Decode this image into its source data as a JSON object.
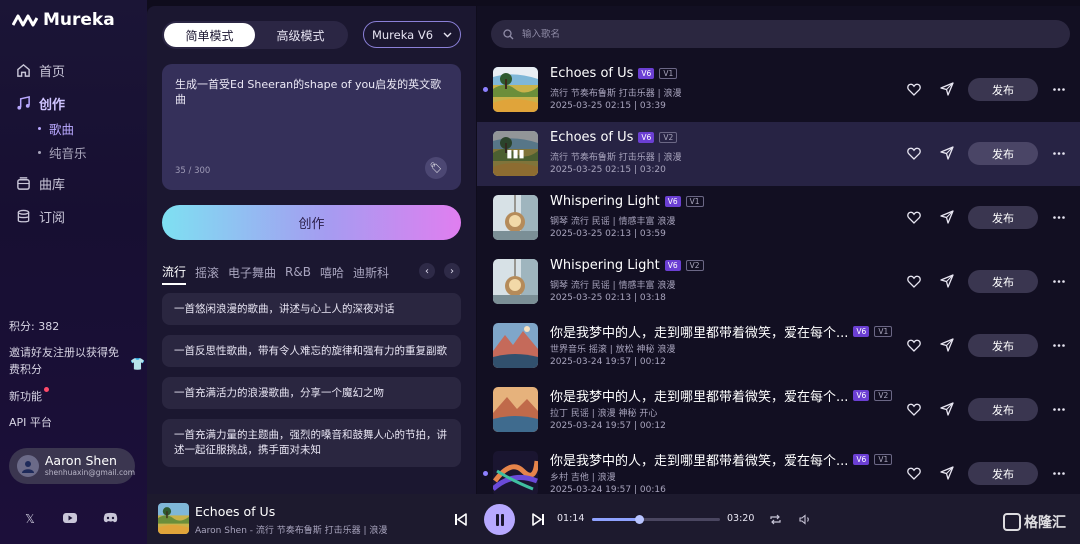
{
  "app": {
    "name": "Mureka"
  },
  "sidebar": {
    "nav": [
      {
        "label": "首页",
        "icon": "home-icon"
      },
      {
        "label": "创作",
        "icon": "music-note-icon",
        "active": true
      },
      {
        "label": "曲库",
        "icon": "library-icon"
      },
      {
        "label": "订阅",
        "icon": "database-icon"
      }
    ],
    "sub_nav": [
      {
        "label": "歌曲",
        "active": true
      },
      {
        "label": "纯音乐"
      }
    ],
    "credits": "积分: 382",
    "invite": "邀请好友注册以获得免费积分",
    "new_features": "新功能",
    "api": "API 平台",
    "user": {
      "name": "Aaron Shen",
      "email": "shenhuaxin@gmail.com"
    },
    "socials": [
      "x-icon",
      "youtube-icon",
      "discord-icon"
    ]
  },
  "create": {
    "modes": [
      "简单模式",
      "高级模式"
    ],
    "active_mode": "简单模式",
    "version": "Mureka V6",
    "prompt": "生成一首受Ed Sheeran的shape of you启发的英文歌曲",
    "counter": "35 / 300",
    "create_label": "创作",
    "genres": [
      "流行",
      "摇滚",
      "电子舞曲",
      "R&B",
      "嘻哈",
      "迪斯科"
    ],
    "active_genre": "流行",
    "suggestions": [
      "一首悠闲浪漫的歌曲，讲述与心上人的深夜对话",
      "一首反思性歌曲，带有令人难忘的旋律和强有力的重复副歌",
      "一首充满活力的浪漫歌曲，分享一个魔幻之吻",
      "一首充满力量的主题曲，强烈的嗓音和鼓舞人心的节拍，讲述一起征服挑战，携手面对未知"
    ]
  },
  "list": {
    "search_placeholder": "输入歌名",
    "publish_label": "发布",
    "songs": [
      {
        "title": "Echoes of Us",
        "version": "V1",
        "tags": "流行 节奏布鲁斯 打击乐器 | 浪漫",
        "date": "2025-03-25 02:15",
        "duration": "03:39",
        "thumb": "meadow"
      },
      {
        "title": "Echoes of Us",
        "version": "V2",
        "tags": "流行 节奏布鲁斯 打击乐器 | 浪漫",
        "date": "2025-03-25 02:15",
        "duration": "03:20",
        "thumb": "meadow"
      },
      {
        "title": "Whispering Light",
        "version": "V1",
        "tags": "钢琴 流行 民谣 | 情感丰富 浪漫",
        "date": "2025-03-25 02:13",
        "duration": "03:59",
        "thumb": "lamp"
      },
      {
        "title": "Whispering Light",
        "version": "V2",
        "tags": "钢琴 流行 民谣 | 情感丰富 浪漫",
        "date": "2025-03-25 02:13",
        "duration": "03:18",
        "thumb": "lamp"
      },
      {
        "title": "你是我梦中的人，走到哪里都带着微笑，爱在每个...",
        "version": "V1",
        "tags": "世界音乐 摇滚 | 放松 神秘 浪漫",
        "date": "2025-03-24 19:57",
        "duration": "00:12",
        "thumb": "mountain"
      },
      {
        "title": "你是我梦中的人，走到哪里都带着微笑，爱在每个...",
        "version": "V2",
        "tags": "拉丁 民谣 | 浪漫 神秘 开心",
        "date": "2025-03-24 19:57",
        "duration": "00:12",
        "thumb": "mountain2"
      },
      {
        "title": "你是我梦中的人，走到哪里都带着微笑，爱在每个...",
        "version": "V1",
        "tags": "乡村 吉他 | 浪漫",
        "date": "2025-03-24 19:57",
        "duration": "00:16",
        "thumb": "swirl"
      }
    ],
    "model_badge": "V6"
  },
  "player": {
    "title": "Echoes of Us",
    "subtitle": "Aaron Shen - 流行 节奏布鲁斯 打击乐器 | 浪漫",
    "current": "01:14",
    "total": "03:20",
    "progress": 0.37
  },
  "watermark": "格隆汇",
  "colors": {
    "accent": "#b7a9ff",
    "badge": "#6b3fd3",
    "gradient_start": "#7ee0f2",
    "gradient_end": "#e07ef0"
  }
}
